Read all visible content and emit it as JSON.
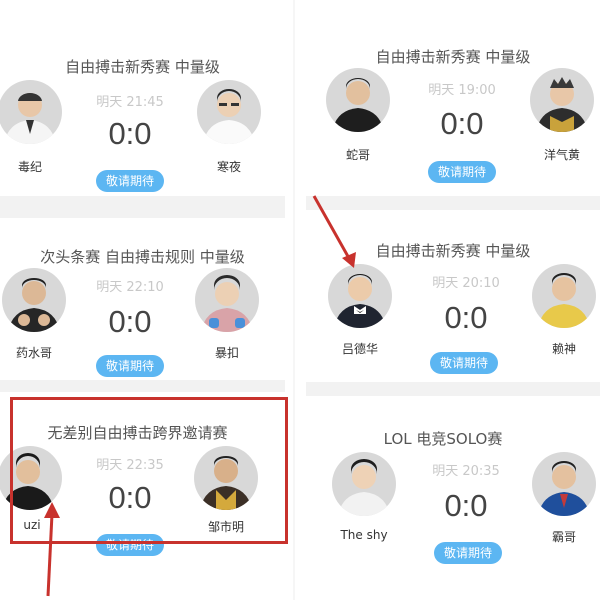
{
  "colors": {
    "button": "#5cb6f2",
    "title_text": "#555555",
    "time_text": "#c8c8c8",
    "highlight": "#c8322d",
    "avatar_bg": "#d8d8d8"
  },
  "cards": [
    {
      "title": "自由搏击新秀赛 中量级",
      "time": "明天 21:45",
      "score": "0:0",
      "button": "敬请期待",
      "left_player": "毒纪",
      "right_player": "寒夜"
    },
    {
      "title": "自由搏击新秀赛 中量级",
      "time": "明天 19:00",
      "score": "0:0",
      "button": "敬请期待",
      "left_player": "蛇哥",
      "right_player": "洋气黄"
    },
    {
      "title": "次头条赛 自由搏击规则 中量级",
      "time": "明天 22:10",
      "score": "0:0",
      "button": "敬请期待",
      "left_player": "药水哥",
      "right_player": "暴扣"
    },
    {
      "title": "自由搏击新秀赛 中量级",
      "time": "明天 20:10",
      "score": "0:0",
      "button": "敬请期待",
      "left_player": "吕德华",
      "right_player": "赖神"
    },
    {
      "title": "无差别自由搏击跨界邀请赛",
      "time": "明天 22:35",
      "score": "0:0",
      "button": "敬请期待",
      "left_player": "uzi",
      "right_player": "邹市明"
    },
    {
      "title": "LOL 电竞SOLO赛",
      "time": "明天 20:35",
      "score": "0:0",
      "button": "敬请期待",
      "left_player": "The shy",
      "right_player": "霸哥"
    }
  ]
}
